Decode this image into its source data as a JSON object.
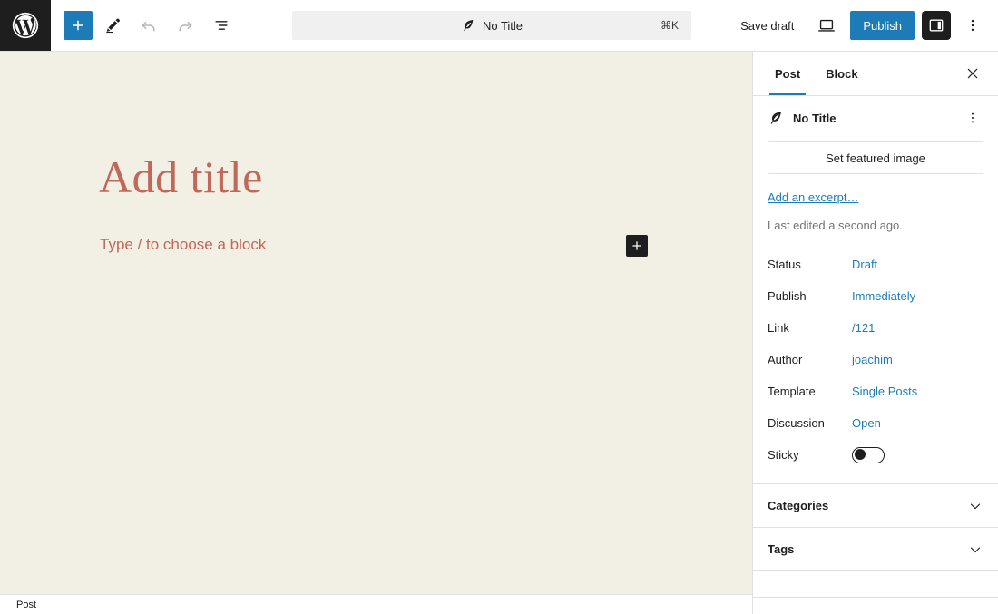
{
  "header": {
    "logo_icon": "wordpress-logo-icon",
    "tools": [
      {
        "name": "block-inserter-toggle",
        "icon": "plus-icon",
        "state": "active"
      },
      {
        "name": "edit-mode-tool",
        "icon": "pencil-icon",
        "state": "default"
      },
      {
        "name": "undo-button",
        "icon": "undo-arrow-icon",
        "state": "disabled"
      },
      {
        "name": "redo-button",
        "icon": "redo-arrow-icon",
        "state": "disabled"
      },
      {
        "name": "document-overview-button",
        "icon": "list-view-icon",
        "state": "default"
      }
    ],
    "command_bar": {
      "icon": "quill-pen-icon",
      "title": "No Title",
      "shortcut": "⌘K"
    },
    "save_draft_label": "Save draft",
    "preview_icon": "laptop-preview-icon",
    "publish_label": "Publish",
    "sidebar_toggle_icon": "sidebar-panel-icon",
    "options_icon": "three-dots-vertical-icon"
  },
  "canvas": {
    "title_placeholder": "Add title",
    "paragraph_placeholder": "Type / to choose a block",
    "inserter_icon": "plus-icon",
    "background_color": "#f2f0e4",
    "placeholder_color": "#c0685a"
  },
  "statusbar": {
    "breadcrumb": "Post"
  },
  "sidebar": {
    "tabs": [
      {
        "label": "Post",
        "active": true
      },
      {
        "label": "Block",
        "active": false
      }
    ],
    "close_icon": "close-x-icon",
    "post_summary": {
      "icon": "quill-pen-icon",
      "title": "No Title",
      "actions_icon": "three-dots-vertical-icon",
      "featured_image_label": "Set featured image",
      "excerpt_link": "Add an excerpt…",
      "last_edited": "Last edited a second ago."
    },
    "meta": [
      {
        "label": "Status",
        "value": "Draft",
        "type": "link"
      },
      {
        "label": "Publish",
        "value": "Immediately",
        "type": "link"
      },
      {
        "label": "Link",
        "value": "/121",
        "type": "link"
      },
      {
        "label": "Author",
        "value": "joachim",
        "type": "link"
      },
      {
        "label": "Template",
        "value": "Single Posts",
        "type": "link"
      },
      {
        "label": "Discussion",
        "value": "Open",
        "type": "link"
      },
      {
        "label": "Sticky",
        "value": "",
        "type": "toggle",
        "toggle_on": false
      }
    ],
    "panels": [
      {
        "title": "Categories",
        "icon": "chevron-down-icon",
        "expanded": false
      },
      {
        "title": "Tags",
        "icon": "chevron-down-icon",
        "expanded": false
      }
    ]
  },
  "colors": {
    "accent_blue": "#1d7cb8",
    "dark": "#1e1e1e",
    "border": "#e0e0e0",
    "muted_text": "#757575"
  }
}
